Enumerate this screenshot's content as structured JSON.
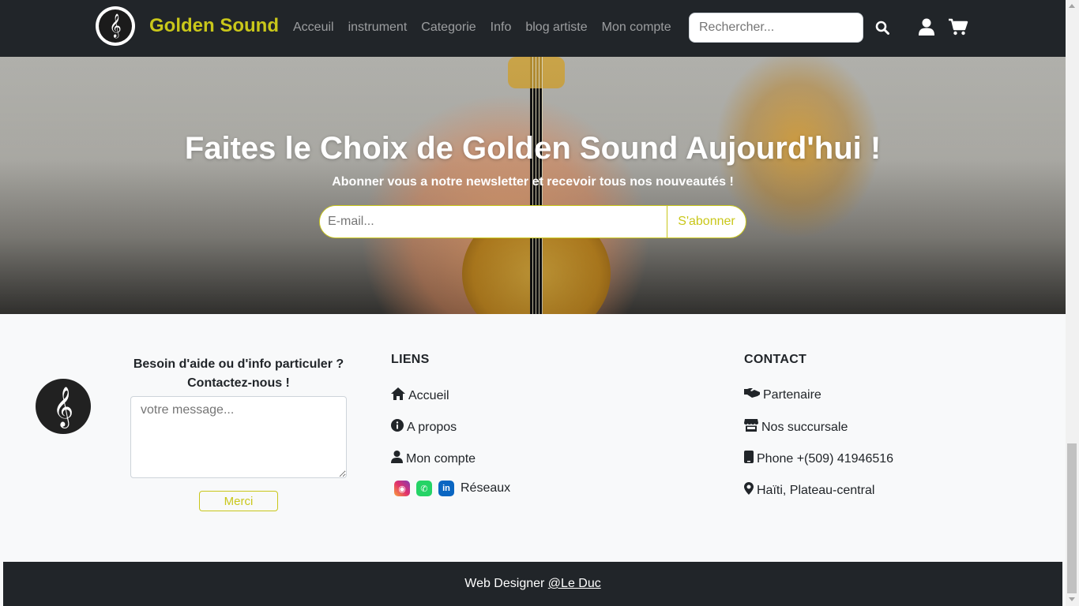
{
  "navbar": {
    "brand": "Golden Sound",
    "links": [
      "Acceuil",
      "instrument",
      "Categorie",
      "Info",
      "blog artiste",
      "Mon compte"
    ],
    "search_placeholder": "Rechercher..."
  },
  "hero": {
    "title": "Faites le Choix de Golden Sound Aujourd'hui !",
    "subtitle": "Abonner vous a notre newsletter et recevoir tous nos nouveautés !",
    "email_placeholder": "E-mail...",
    "subscribe_label": "S'abonner"
  },
  "help": {
    "title_line1": "Besoin d'aide ou d'info particuler ?",
    "title_line2": "Contactez-nous !",
    "message_placeholder": "votre message...",
    "submit_label": "Merci"
  },
  "links": {
    "title": "LIENS",
    "items": [
      "Accueil",
      "A propos",
      "Mon compte",
      "Réseaux"
    ]
  },
  "contact": {
    "title": "CONTACT",
    "items": [
      "Partenaire",
      "Nos succursale",
      "Phone +(509) 41946516",
      "Haïti, Plateau-central"
    ]
  },
  "footer": {
    "credit_prefix": "Web Designer ",
    "credit_link": "@Le Duc"
  },
  "colors": {
    "accent": "#c9c71a",
    "dark": "#212529",
    "light": "#f8f9fa"
  }
}
